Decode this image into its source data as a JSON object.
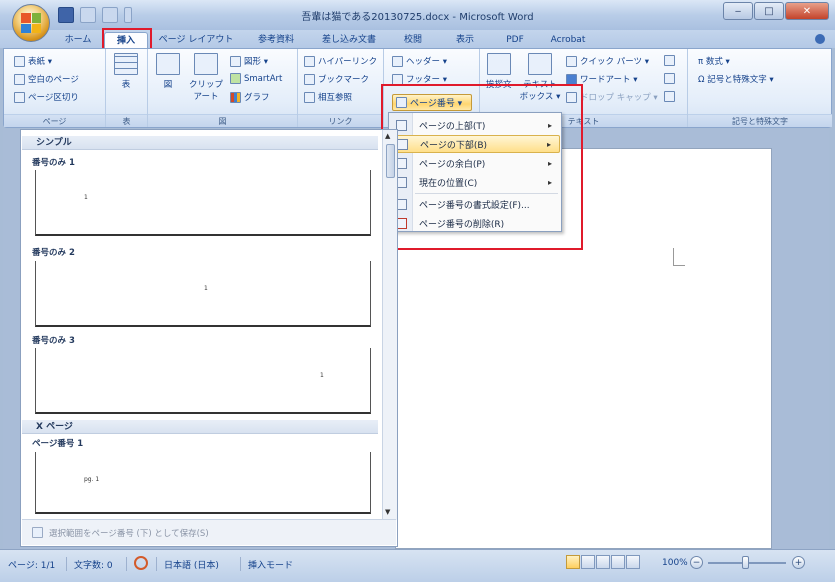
{
  "window": {
    "title": "吾輩は猫である20130725.docx - Microsoft Word",
    "minimize": "‒",
    "maximize": "□",
    "close": "✕"
  },
  "tabs": [
    {
      "label": "ホーム"
    },
    {
      "label": "挿入",
      "active": true
    },
    {
      "label": "ページ レイアウト"
    },
    {
      "label": "参考資料"
    },
    {
      "label": "差し込み文書"
    },
    {
      "label": "校閲"
    },
    {
      "label": "表示"
    },
    {
      "label": "PDF"
    },
    {
      "label": "Acrobat"
    }
  ],
  "ribbon": {
    "page_group": {
      "label": "ページ",
      "items": [
        "表紙 ▾",
        "空白のページ",
        "ページ区切り"
      ]
    },
    "table_group": {
      "label": "表",
      "button": "表"
    },
    "illustrations_group": {
      "label": "図",
      "picture": "図",
      "clipart": "クリップ アート",
      "shapes": "図形 ▾",
      "smartart": "SmartArt",
      "chart": "グラフ"
    },
    "links_group": {
      "label": "リンク",
      "items": [
        "ハイパーリンク",
        "ブックマーク",
        "相互参照"
      ]
    },
    "header_group": {
      "header": "ヘッダー ▾",
      "footer": "フッター ▾",
      "page_number": "ページ番号 ▾"
    },
    "text_group": {
      "label": "テキスト",
      "greeting": "挨拶文",
      "textbox": "テキスト ボックス ▾",
      "quickparts": "クイック パーツ ▾",
      "wordart": "ワードアート ▾",
      "dropcap": "ドロップ キャップ ▾"
    },
    "symbols_group": {
      "label": "記号と特殊文字",
      "equation": "π 数式 ▾",
      "symbol": "Ω 記号と特殊文字 ▾"
    }
  },
  "page_number_menu": {
    "items": [
      {
        "label": "ページの上部(T)",
        "submenu": true
      },
      {
        "label": "ページの下部(B)",
        "submenu": true,
        "highlighted": true
      },
      {
        "label": "ページの余白(P)",
        "submenu": true
      },
      {
        "label": "現在の位置(C)",
        "submenu": true
      },
      {
        "label": "ページ番号の書式設定(F)..."
      },
      {
        "label": "ページ番号の削除(R)"
      }
    ],
    "arrow": "▸"
  },
  "gallery": {
    "section1": "シンプル",
    "section2": "X ページ",
    "items": [
      {
        "label": "番号のみ 1",
        "sample": "1"
      },
      {
        "label": "番号のみ 2",
        "sample": "1"
      },
      {
        "label": "番号のみ 3",
        "sample": "1"
      },
      {
        "label": "ページ番号 1",
        "sample": "pg. 1"
      }
    ],
    "footer": "選択範囲をページ番号 (下) として保存(S)"
  },
  "statusbar": {
    "page": "ページ: 1/1",
    "words": "文字数: 0",
    "language": "日本語 (日本)",
    "mode": "挿入モード",
    "zoom": "100%",
    "zoom_minus": "−",
    "zoom_plus": "+"
  }
}
